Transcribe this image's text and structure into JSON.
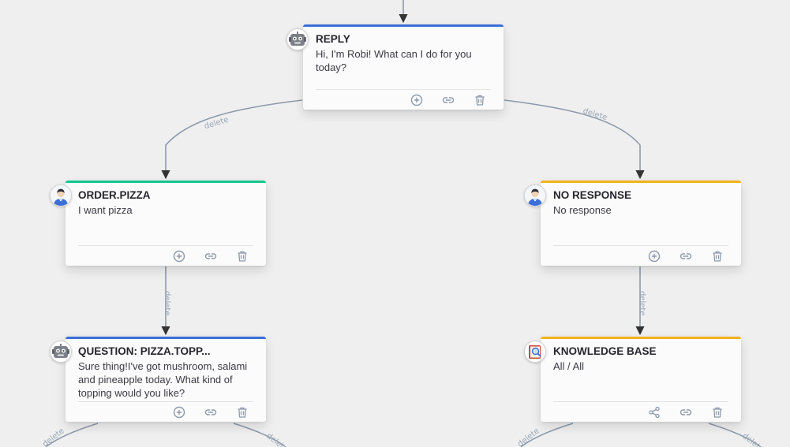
{
  "colors": {
    "bot_bar": "#3b6fd6",
    "intent_bar": "#17c590",
    "fallback_bar": "#f1b21d",
    "edge": "#8c9aad",
    "icon": "#8d99ab"
  },
  "edge_label": "delete",
  "nodes": {
    "reply": {
      "title": "REPLY",
      "text": "Hi, I'm Robi! What can I do for you today?",
      "avatar_icon": "robot-icon",
      "actions": [
        "add-icon",
        "link-icon",
        "trash-icon"
      ]
    },
    "order_pizza": {
      "title": "ORDER.PIZZA",
      "text": "I want pizza",
      "avatar_icon": "user-icon",
      "actions": [
        "add-icon",
        "link-icon",
        "trash-icon"
      ]
    },
    "no_response": {
      "title": "NO RESPONSE",
      "text": "No response",
      "avatar_icon": "user-icon",
      "actions": [
        "add-icon",
        "link-icon",
        "trash-icon"
      ]
    },
    "question": {
      "title": "QUESTION: PIZZA.TOPP...",
      "text": "Sure thing!I've got mushroom, salami and pineapple today. What kind of topping would you like?",
      "avatar_icon": "robot-icon",
      "actions": [
        "add-icon",
        "link-icon",
        "trash-icon"
      ]
    },
    "knowledge_base": {
      "title": "KNOWLEDGE BASE",
      "text": "All / All",
      "avatar_icon": "book-search-icon",
      "actions": [
        "share-icon",
        "link-icon",
        "trash-icon"
      ]
    }
  }
}
